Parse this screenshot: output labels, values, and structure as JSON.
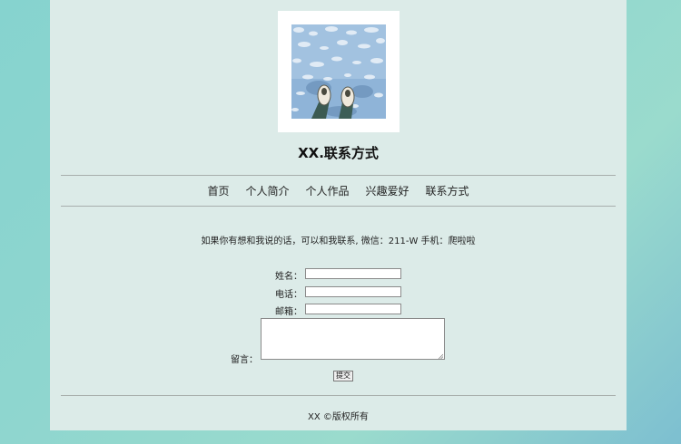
{
  "header": {
    "site_title": "XX.联系方式"
  },
  "nav": {
    "items": [
      {
        "label": "首页"
      },
      {
        "label": "个人简介"
      },
      {
        "label": "个人作品"
      },
      {
        "label": "兴趣爱好"
      },
      {
        "label": "联系方式"
      }
    ]
  },
  "main": {
    "intro": "如果你有想和我说的话，可以和我联系, 微信：211-W 手机：爬啦啦"
  },
  "form": {
    "name_label": "姓名：",
    "phone_label": "电话：",
    "email_label": "邮箱：",
    "message_label": "留言：",
    "submit_label": "提交",
    "name_value": "",
    "phone_value": "",
    "email_value": "",
    "message_value": ""
  },
  "footer": {
    "text": "XX ©版权所有"
  }
}
